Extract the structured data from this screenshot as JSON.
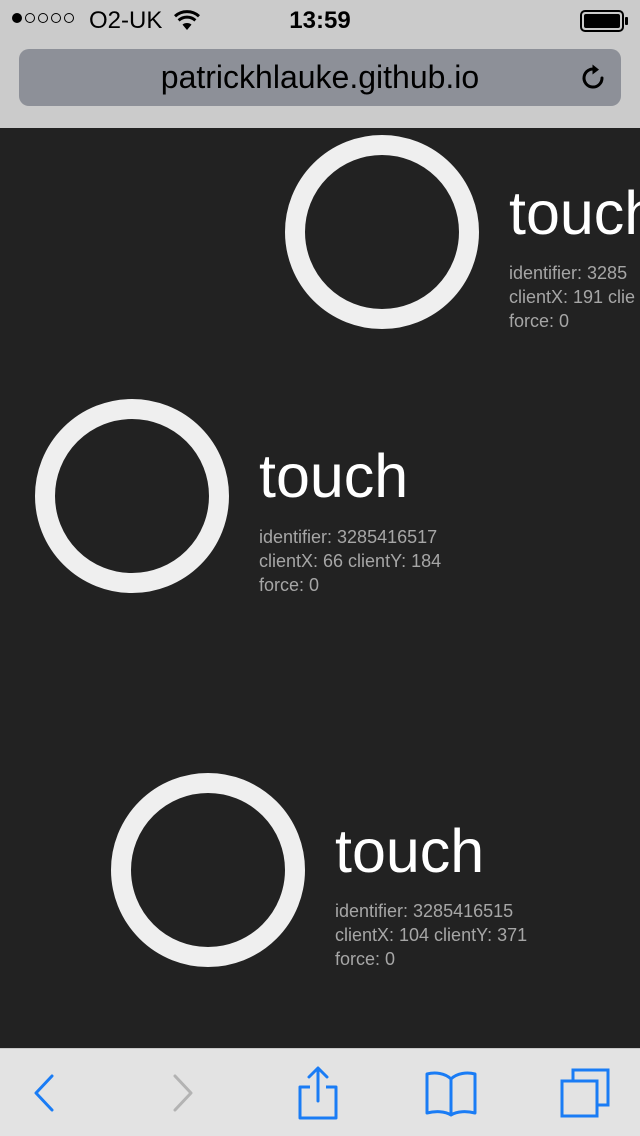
{
  "status_bar": {
    "carrier": "O2-UK",
    "time": "13:59",
    "signal_bars_filled": 1,
    "signal_bars_total": 5
  },
  "browser": {
    "url": "patrickhlauke.github.io"
  },
  "touches": [
    {
      "title": "touch",
      "identifier_line": "identifier: 3285",
      "client_line": "clientX: 191 clie",
      "force_line": "force: 0"
    },
    {
      "title": "touch",
      "identifier_line": "identifier: 3285416517",
      "client_line": "clientX: 66 clientY: 184",
      "force_line": "force: 0"
    },
    {
      "title": "touch",
      "identifier_line": "identifier: 3285416515",
      "client_line": "clientX: 104 clientY: 371",
      "force_line": "force: 0"
    }
  ],
  "toolbar": {
    "icons": [
      "back-icon",
      "forward-icon",
      "share-icon",
      "bookmarks-icon",
      "tabs-icon"
    ]
  },
  "colors": {
    "content_background": "#222222",
    "ring": "#efefef",
    "title_text": "#ffffff",
    "info_text": "#a6a6a6",
    "ios_blue": "#1a7cf5"
  }
}
